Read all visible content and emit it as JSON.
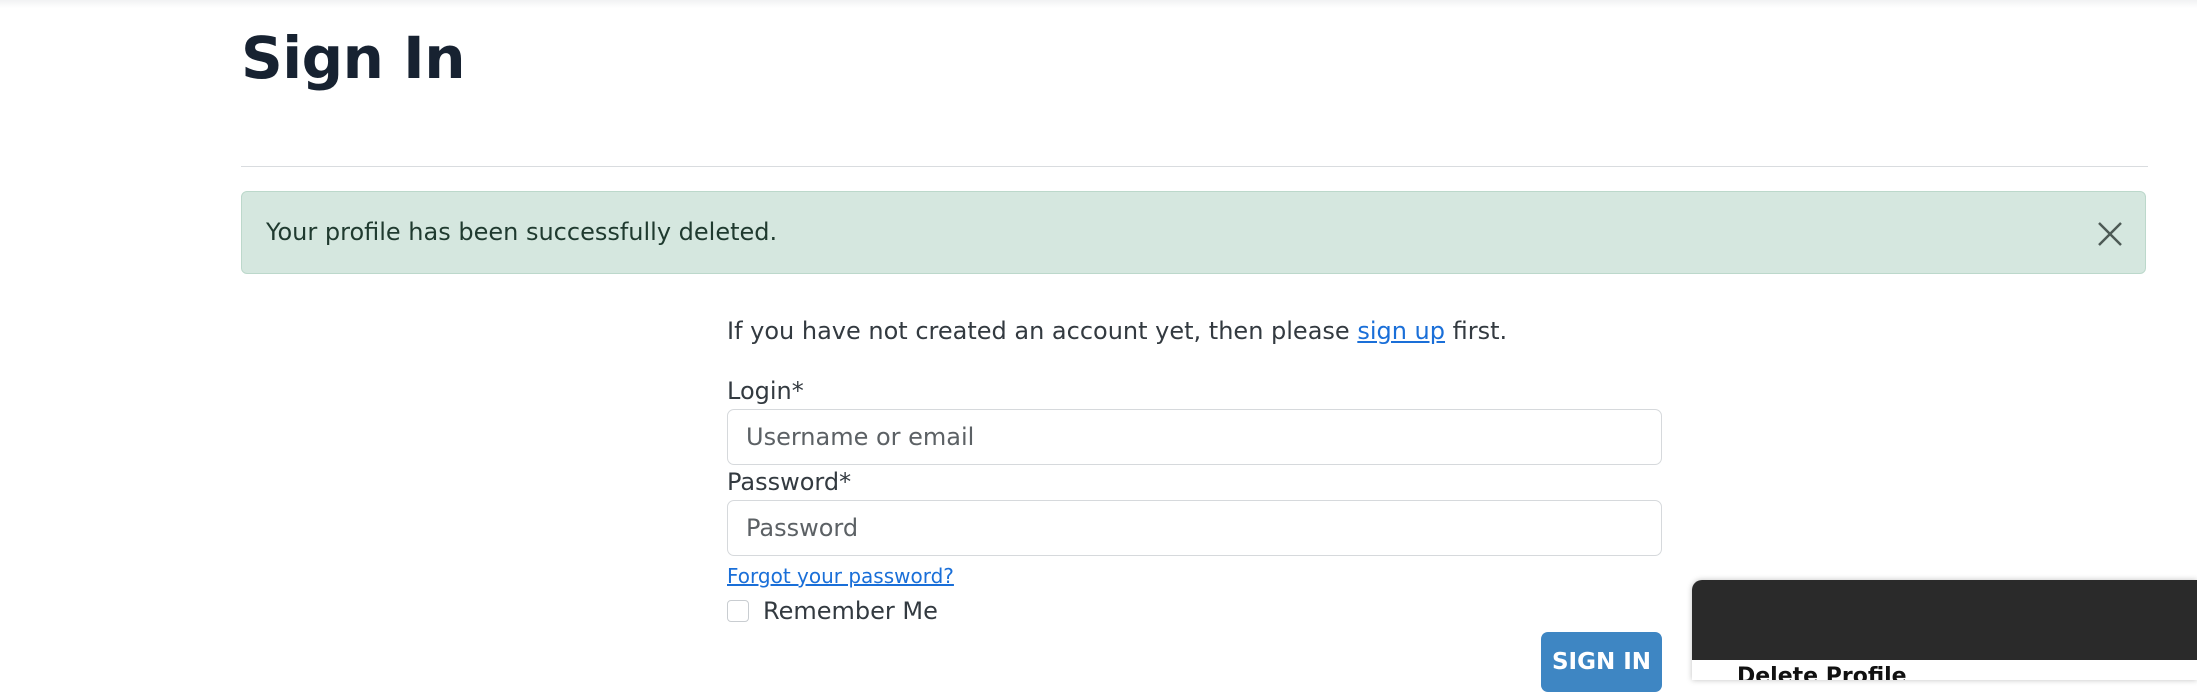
{
  "page": {
    "title": "Sign In"
  },
  "alert": {
    "message": "Your profile has been successfully deleted.",
    "close_icon": "close-icon"
  },
  "intro": {
    "before": "If you have not created an account yet, then please ",
    "link": "sign up",
    "after": " first."
  },
  "form": {
    "login_label": "Login*",
    "login_placeholder": "Username or email",
    "login_value": "",
    "password_label": "Password*",
    "password_placeholder": "Password",
    "password_value": "",
    "forgot_link": "Forgot your password?",
    "remember_label": "Remember Me",
    "remember_checked": false,
    "submit_label": "SIGN IN"
  },
  "popup": {
    "title": "Delete Profile"
  },
  "colors": {
    "title": "#172231",
    "alert_bg": "#d5e7df",
    "link": "#1a6fd8",
    "button": "#3e86c3",
    "popup_header": "#2a2a2a"
  }
}
